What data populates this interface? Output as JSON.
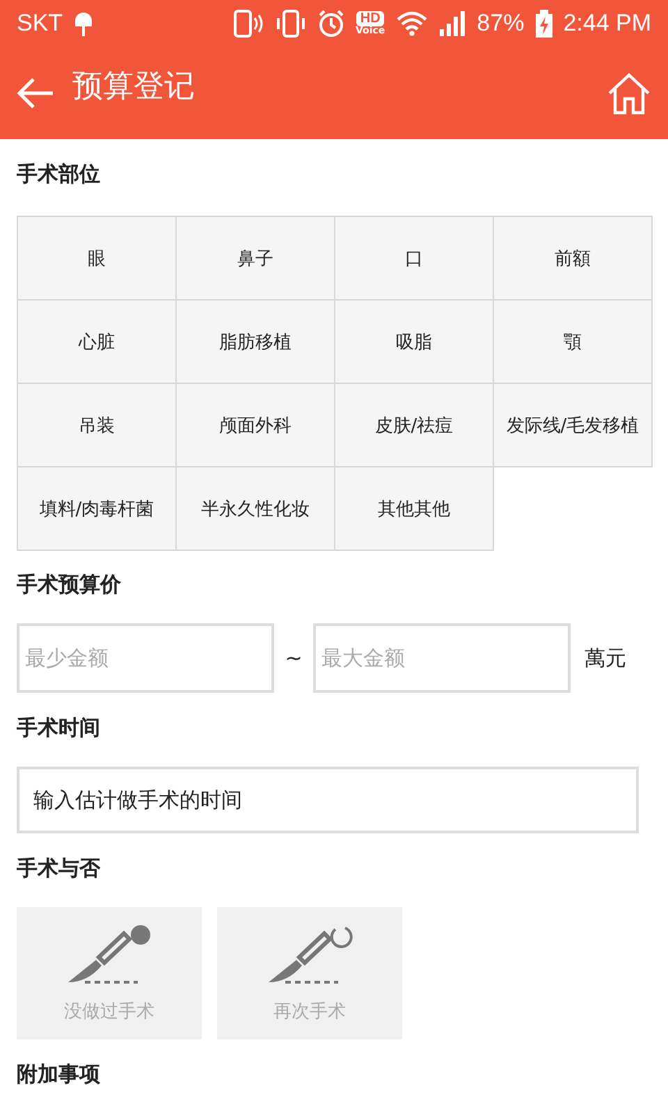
{
  "status_bar": {
    "carrier": "SKT",
    "hd_badge": "HD",
    "hd_label": "Voice",
    "battery": "87%",
    "time": "2:44 PM"
  },
  "header": {
    "title": "预算登记"
  },
  "sections": [
    {
      "kind": "grid",
      "title": "手术部位",
      "items": [
        {
          "label": "眼",
          "selected": false
        },
        {
          "label": "鼻子",
          "selected": false
        },
        {
          "label": "口",
          "selected": false
        },
        {
          "label": "前額",
          "selected": false
        },
        {
          "label": "心脏",
          "selected": false
        },
        {
          "label": "脂肪移植",
          "selected": false
        },
        {
          "label": "吸脂",
          "selected": false
        },
        {
          "label": "顎",
          "selected": false
        },
        {
          "label": "吊装",
          "selected": false
        },
        {
          "label": "颅面外科",
          "selected": false
        },
        {
          "label": "皮肤/祛痘",
          "selected": false
        },
        {
          "label": "发际线/毛发移植",
          "selected": false
        },
        {
          "label": "填料/肉毒杆菌",
          "selected": false
        },
        {
          "label": "半永久性化妆",
          "selected": false
        },
        {
          "label": "其他其他",
          "selected": false
        }
      ]
    },
    {
      "kind": "range",
      "title": "手术预算价",
      "min_placeholder": "最少金额",
      "separator": "~",
      "max_placeholder": "最大金额",
      "unit": "萬元"
    },
    {
      "kind": "picker",
      "title": "手术时间",
      "value": "输入估计做手术的时间"
    },
    {
      "kind": "options",
      "title": "手术与否",
      "items": [
        {
          "label": "没做过手术",
          "kind": "first",
          "selected": false
        },
        {
          "label": "再次手术",
          "kind": "repeat",
          "selected": false
        }
      ]
    },
    {
      "kind": "heading",
      "title": "附加事项"
    }
  ]
}
